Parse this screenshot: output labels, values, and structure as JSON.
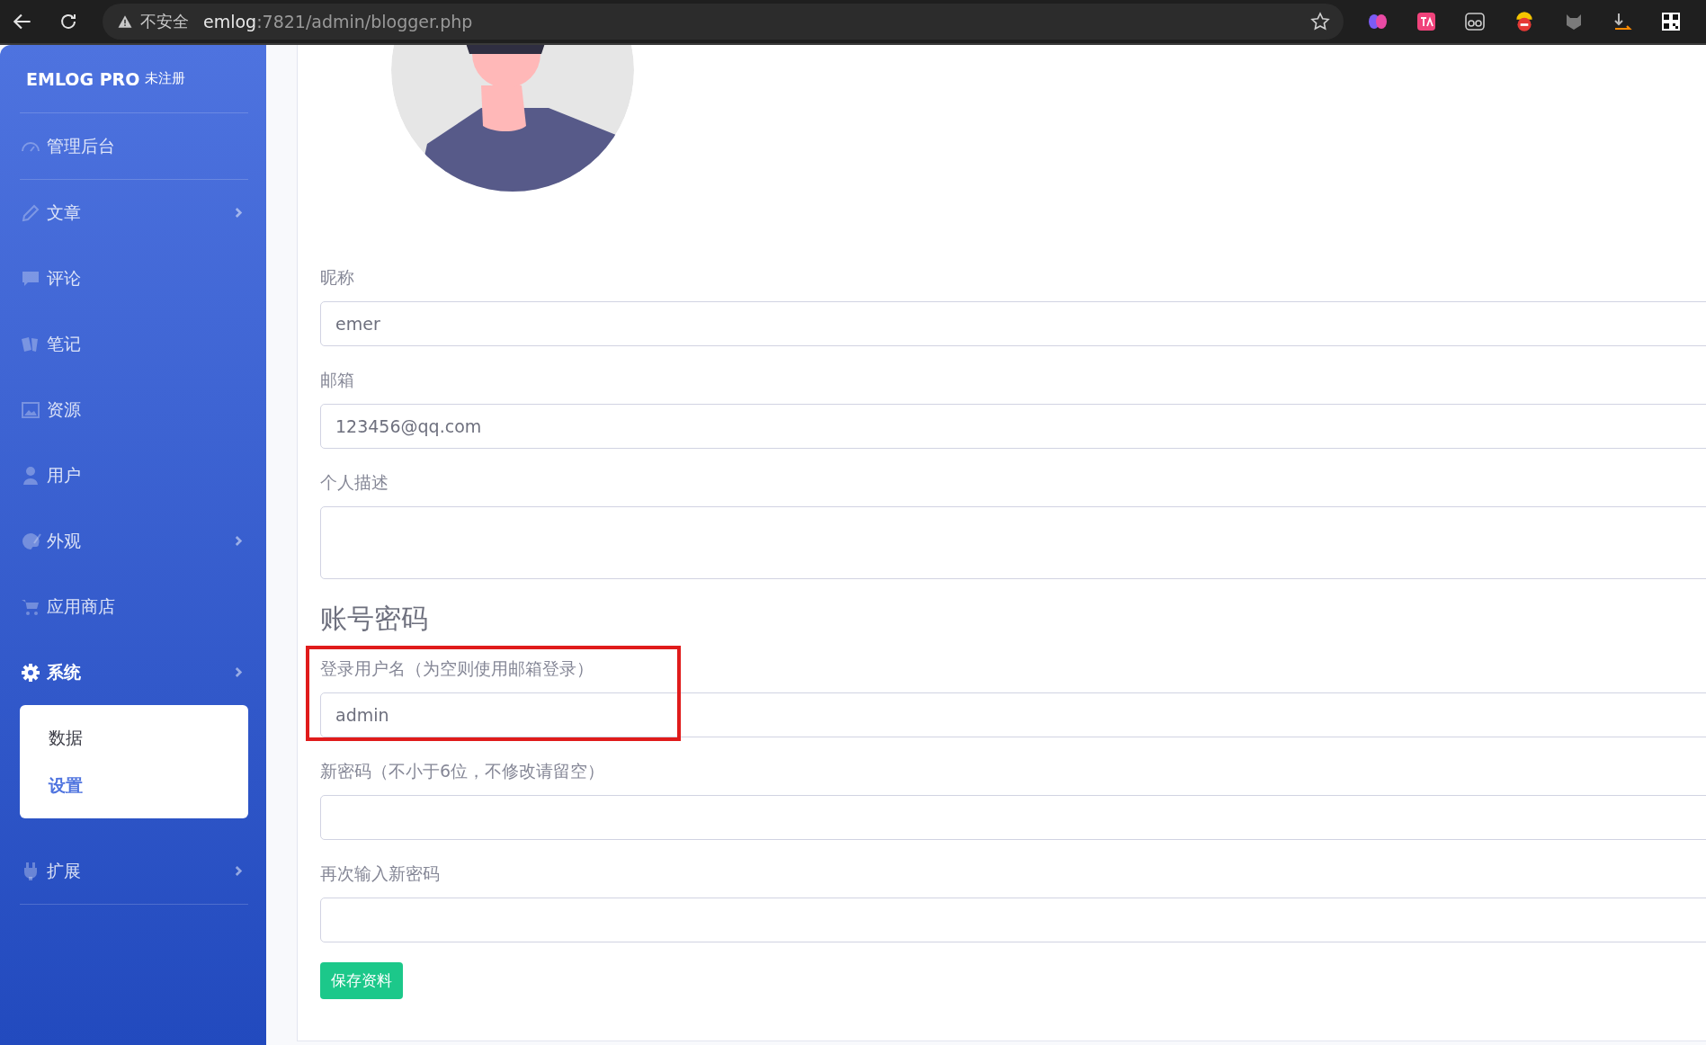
{
  "browser": {
    "security": "不安全",
    "url_host": "emlog",
    "url_path": ":7821/admin/blogger.php"
  },
  "sidebar": {
    "brand": "EMLOG PRO",
    "brand_badge": "未注册",
    "items": [
      {
        "label": "管理后台",
        "expandable": false,
        "expanded": false
      },
      {
        "label": "文章",
        "expandable": true,
        "expanded": false
      },
      {
        "label": "评论",
        "expandable": false,
        "expanded": false
      },
      {
        "label": "笔记",
        "expandable": false,
        "expanded": false
      },
      {
        "label": "资源",
        "expandable": false,
        "expanded": false
      },
      {
        "label": "用户",
        "expandable": false,
        "expanded": false
      },
      {
        "label": "外观",
        "expandable": true,
        "expanded": false
      },
      {
        "label": "应用商店",
        "expandable": false,
        "expanded": false
      },
      {
        "label": "系统",
        "expandable": true,
        "expanded": true,
        "children": [
          {
            "label": "数据",
            "selected": false
          },
          {
            "label": "设置",
            "selected": true
          }
        ]
      },
      {
        "label": "扩展",
        "expandable": true,
        "expanded": false
      }
    ]
  },
  "profile_form": {
    "fields": [
      {
        "kind": "input",
        "label": "昵称",
        "value": "emer"
      },
      {
        "kind": "input",
        "label": "邮箱",
        "value": "123456@qq.com"
      },
      {
        "kind": "textarea",
        "label": "个人描述"
      }
    ]
  },
  "account_section": {
    "heading": "账号密码",
    "fields": [
      {
        "kind": "input",
        "label": "登录用户名（为空则使用邮箱登录）",
        "value": "admin",
        "highlighted": true
      },
      {
        "kind": "input",
        "label": "新密码（不小于6位，不修改请留空）",
        "highlighted": false
      },
      {
        "kind": "input",
        "label": "再次输入新密码",
        "highlighted": false
      }
    ],
    "save_button": "保存资料"
  }
}
